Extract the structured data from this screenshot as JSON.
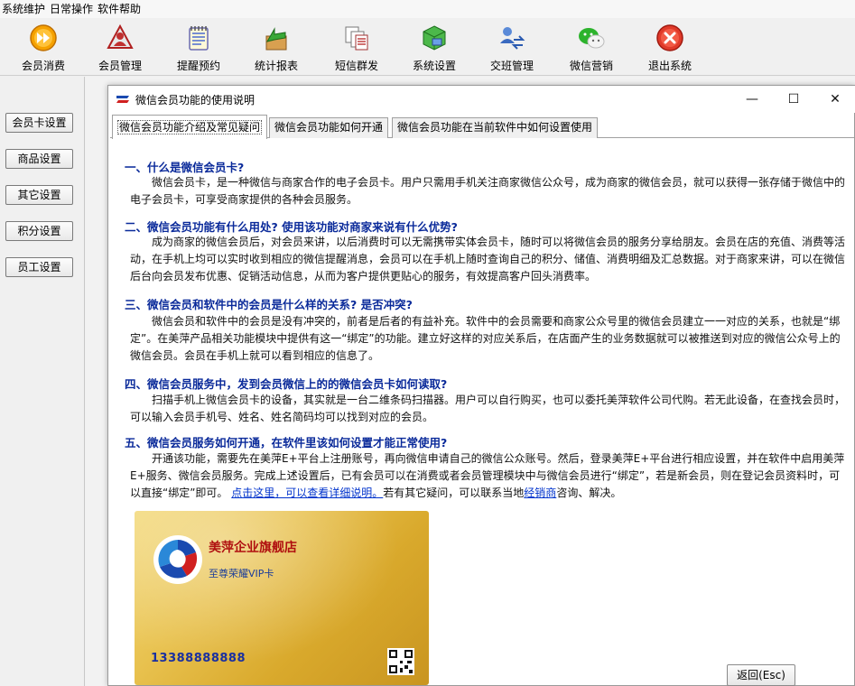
{
  "menubar": [
    "系统维护",
    "日常操作",
    "软件帮助"
  ],
  "toolbar": [
    {
      "label": "会员消费",
      "icon": "forward-circle-icon"
    },
    {
      "label": "会员管理",
      "icon": "member-card-icon"
    },
    {
      "label": "提醒预约",
      "icon": "notepad-icon"
    },
    {
      "label": "统计报表",
      "icon": "chart-arrow-icon"
    },
    {
      "label": "短信群发",
      "icon": "documents-icon"
    },
    {
      "label": "系统设置",
      "icon": "cube-settings-icon"
    },
    {
      "label": "交班管理",
      "icon": "user-swap-icon"
    },
    {
      "label": "微信营销",
      "icon": "wechat-icon"
    },
    {
      "label": "退出系统",
      "icon": "exit-icon"
    }
  ],
  "sidebar": [
    "会员卡设置",
    "商品设置",
    "其它设置",
    "积分设置",
    "员工设置"
  ],
  "dialog": {
    "title": "微信会员功能的使用说明",
    "controls": {
      "minimize": "—",
      "maximize": "☐",
      "close": "✕"
    },
    "tabs": [
      "微信会员功能介绍及常见疑问",
      "微信会员功能如何开通",
      "微信会员功能在当前软件中如何设置使用"
    ],
    "sections": [
      {
        "heading": "一、什么是微信会员卡?",
        "body": "微信会员卡，是一种微信与商家合作的电子会员卡。用户只需用手机关注商家微信公众号，成为商家的微信会员，就可以获得一张存储于微信中的电子会员卡，可享受商家提供的各种会员服务。"
      },
      {
        "heading": "二、微信会员功能有什么用处? 使用该功能对商家来说有什么优势?",
        "body": "成为商家的微信会员后，对会员来讲，以后消费时可以无需携带实体会员卡，随时可以将微信会员的服务分享给朋友。会员在店的充值、消费等活动，在手机上均可以实时收到相应的微信提醒消息，会员可以在手机上随时查询自己的积分、储值、消费明细及汇总数据。对于商家来讲，可以在微信后台向会员发布优惠、促销活动信息，从而为客户提供更贴心的服务，有效提高客户回头消费率。"
      },
      {
        "heading": "三、微信会员和软件中的会员是什么样的关系? 是否冲突?",
        "body": "微信会员和软件中的会员是没有冲突的，前者是后者的有益补充。软件中的会员需要和商家公众号里的微信会员建立一一对应的关系，也就是“绑定”。在美萍产品相关功能模块中提供有这一“绑定”的功能。建立好这样的对应关系后，在店面产生的业务数据就可以被推送到对应的微信公众号上的微信会员。会员在手机上就可以看到相应的信息了。"
      },
      {
        "heading": "四、微信会员服务中，发到会员微信上的的微信会员卡如何读取?",
        "body": "扫描手机上微信会员卡的设备，其实就是一台二维条码扫描器。用户可以自行购买，也可以委托美萍软件公司代购。若无此设备，在查找会员时，可以输入会员手机号、姓名、姓名简码均可以找到对应的会员。"
      },
      {
        "heading": "五、微信会员服务如何开通，在软件里该如何设置才能正常使用?",
        "body_before": "开通该功能，需要先在美萍E+平台上注册账号，再向微信申请自己的微信公众账号。然后，登录美萍E+平台进行相应设置，并在软件中启用美萍E+服务、微信会员服务。完成上述设置后，已有会员可以在消费或者会员管理模块中与微信会员进行“绑定”，若是新会员，则在登记会员资料时，可以直接“绑定”即可。",
        "link1": "点击这里，可以查看详细说明。",
        "body_mid": "若有其它疑问，可以联系当地",
        "link2": "经销商",
        "body_after": "咨询、解决。"
      }
    ],
    "card": {
      "brand": "美萍企业旗舰店",
      "subtitle": "至尊荣耀VIP卡",
      "number": "13388888888",
      "logo_icon": "brand-logo-icon",
      "qr_icon": "qr-code-icon"
    }
  },
  "back_button": "返回(Esc)",
  "colors": {
    "heading": "#0a2a9a",
    "link": "#0033cc",
    "card_gold": "#e8c14e"
  }
}
